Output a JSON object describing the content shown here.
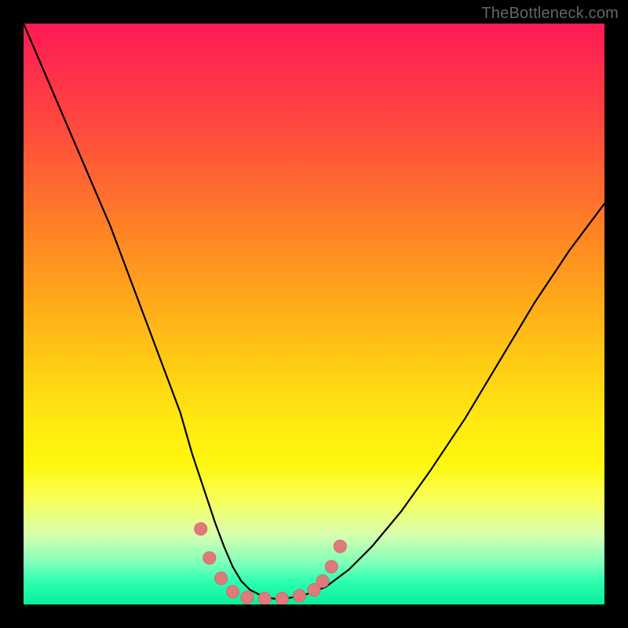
{
  "watermark": {
    "text": "TheBottleneck.com"
  },
  "palette": {
    "curve_stroke": "#000000",
    "marker_fill": "#e17a7a",
    "marker_stroke": "#d06a6a",
    "frame_bg": "#000000"
  },
  "chart_data": {
    "type": "line",
    "title": "",
    "xlabel": "",
    "ylabel": "",
    "xlim": [
      0,
      100
    ],
    "ylim": [
      0,
      100
    ],
    "grid": false,
    "legend": false,
    "series": [
      {
        "name": "bottleneck-curve",
        "x": [
          0,
          3,
          6,
          9,
          12,
          15,
          18,
          21,
          24,
          27,
          29,
          31,
          33,
          34.5,
          36,
          37.5,
          39,
          41,
          43,
          45,
          48,
          52,
          56,
          60,
          65,
          70,
          76,
          82,
          88,
          94,
          100
        ],
        "y": [
          100,
          93,
          86,
          79,
          72,
          65,
          57,
          49,
          41,
          33,
          26,
          20,
          14,
          10,
          6.5,
          4,
          2.5,
          1.5,
          1,
          1,
          1.5,
          3,
          6,
          10,
          16,
          23,
          32,
          42,
          52,
          61,
          69
        ]
      }
    ],
    "markers": [
      {
        "x": 30.5,
        "y": 13
      },
      {
        "x": 32.0,
        "y": 8
      },
      {
        "x": 34.0,
        "y": 4.5
      },
      {
        "x": 36.0,
        "y": 2.2
      },
      {
        "x": 38.5,
        "y": 1.2
      },
      {
        "x": 41.5,
        "y": 1.0
      },
      {
        "x": 44.5,
        "y": 1.0
      },
      {
        "x": 47.5,
        "y": 1.5
      },
      {
        "x": 50.0,
        "y": 2.5
      },
      {
        "x": 51.5,
        "y": 4.0
      },
      {
        "x": 53.0,
        "y": 6.5
      },
      {
        "x": 54.5,
        "y": 10.0
      }
    ]
  }
}
